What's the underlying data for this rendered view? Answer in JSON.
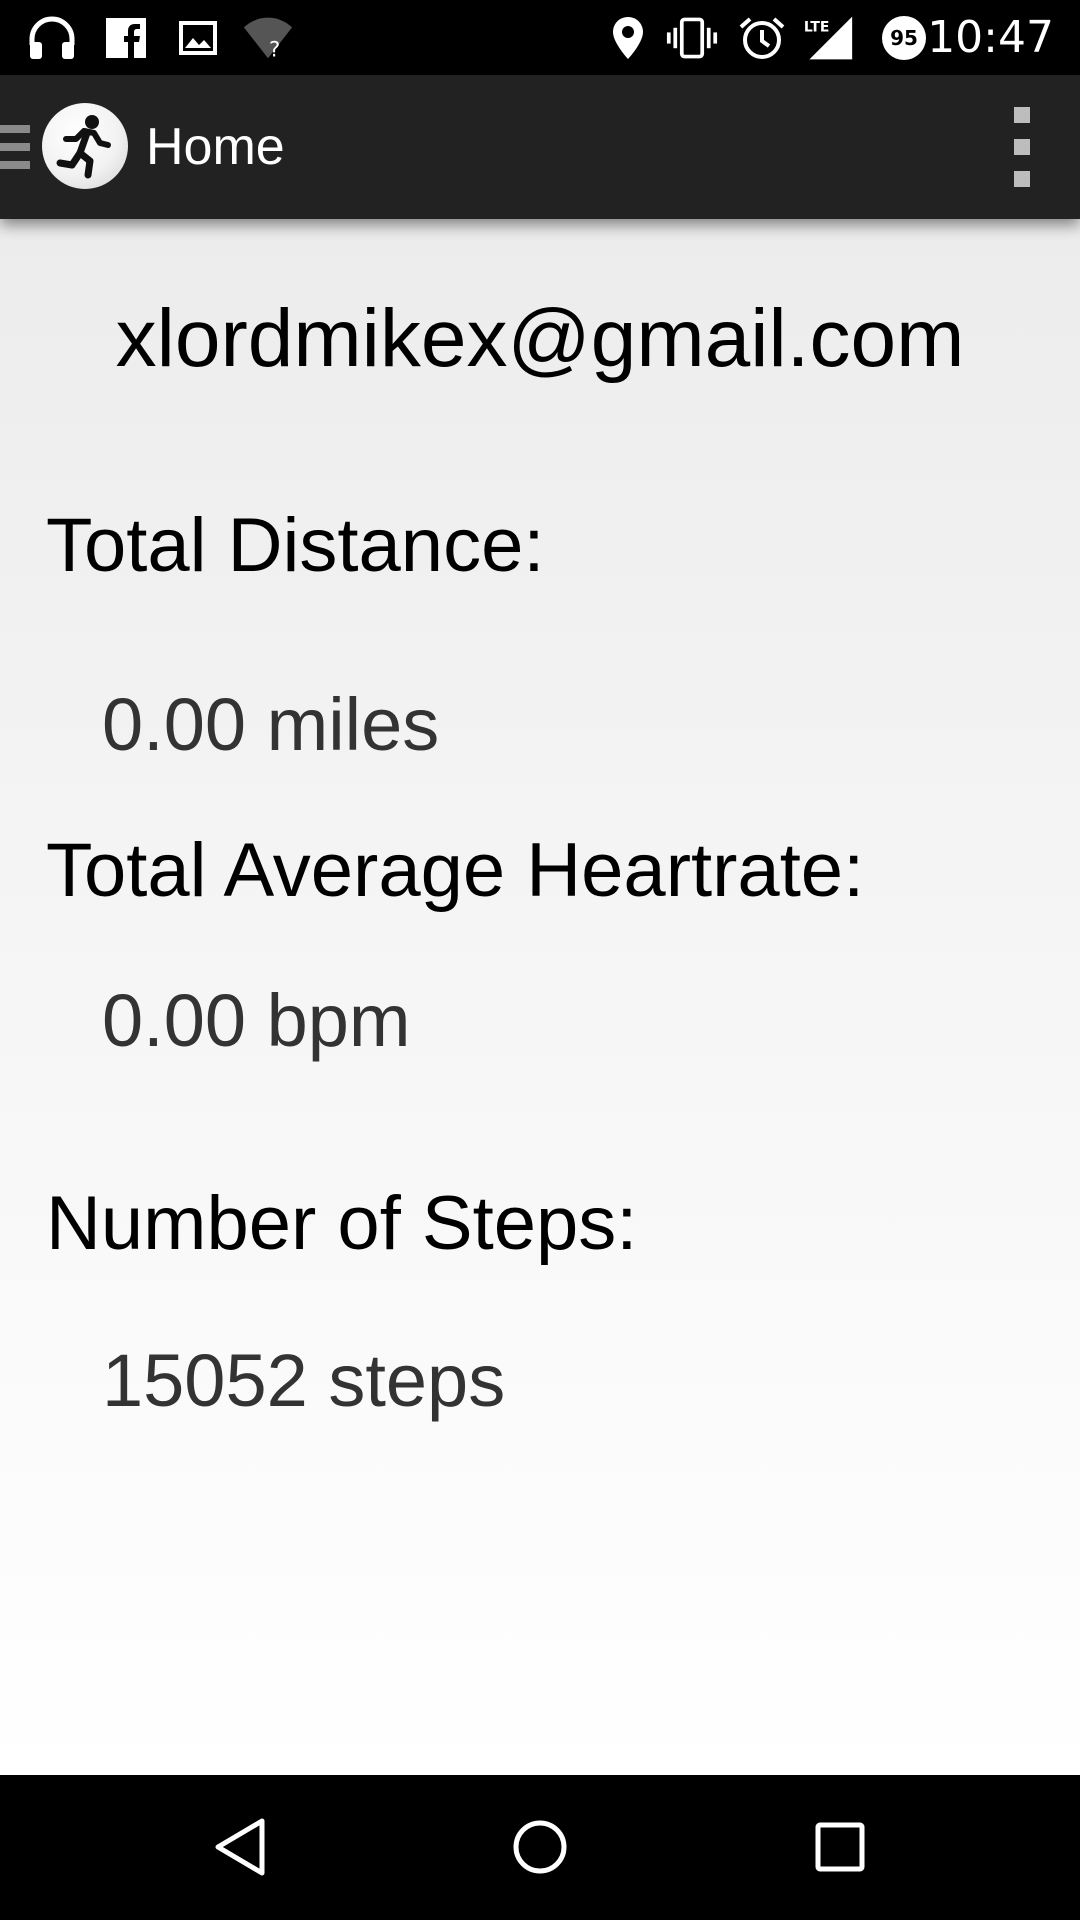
{
  "status_bar": {
    "time": "10:47",
    "battery_level": "95",
    "network_type": "LTE",
    "left_icons": [
      "headphones-icon",
      "facebook-icon",
      "image-icon",
      "wifi-unknown-icon"
    ],
    "right_icons": [
      "location-icon",
      "vibrate-icon",
      "alarm-icon",
      "lte-signal-icon",
      "battery-icon"
    ]
  },
  "action_bar": {
    "title": "Home",
    "logo_icon": "running-man-icon",
    "menu_icon": "overflow-menu-icon"
  },
  "main": {
    "email": "xlordmikex@gmail.com",
    "total_distance_label": "Total Distance:",
    "total_distance_value": "0.00 miles",
    "heartrate_label": "Total Average Heartrate:",
    "heartrate_value": "0.00 bpm",
    "steps_label": "Number of Steps:",
    "steps_value": "15052 steps"
  },
  "nav_bar": {
    "buttons": [
      "back-icon",
      "home-icon",
      "recents-icon"
    ]
  },
  "colors": {
    "status_bar_bg": "#000000",
    "action_bar_bg": "#222222",
    "content_bg_top": "#ececec",
    "content_bg_bottom": "#ffffff",
    "label_text": "#000000",
    "value_text": "#333333"
  }
}
